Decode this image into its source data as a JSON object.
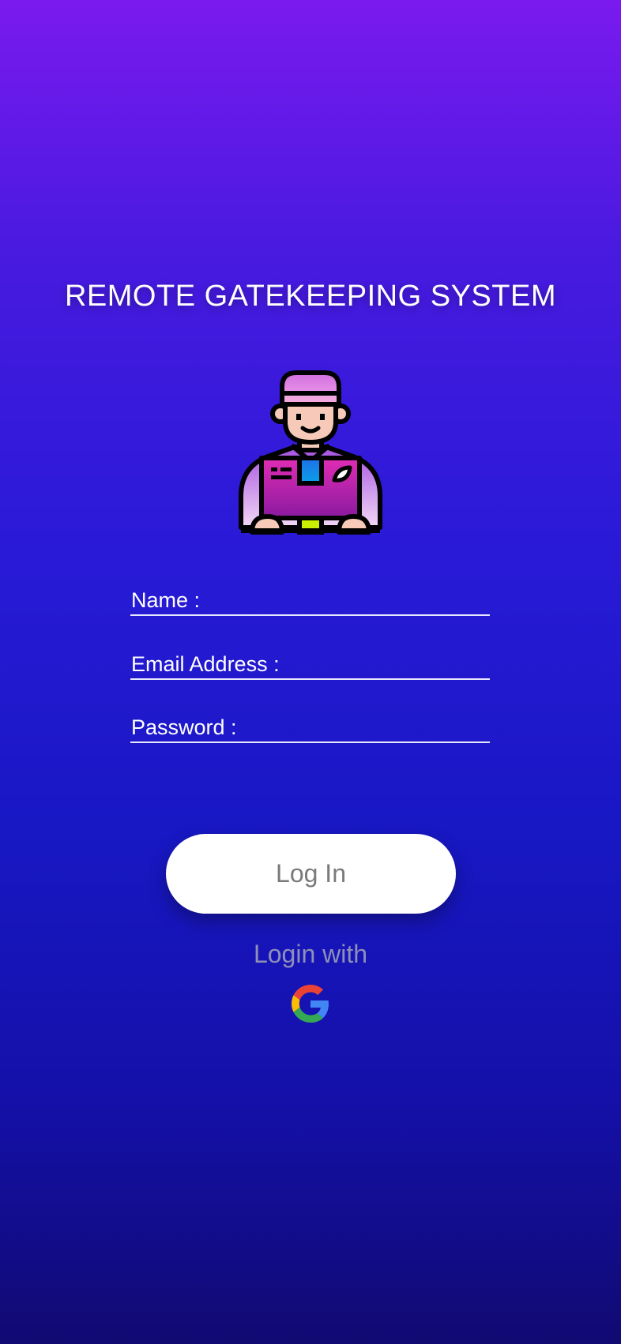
{
  "app": {
    "title": "REMOTE GATEKEEPING SYSTEM"
  },
  "form": {
    "name_label": "Name :",
    "email_label": "Email Address :",
    "password_label": "Password :",
    "name_value": "",
    "email_value": "",
    "password_value": ""
  },
  "actions": {
    "login_label": "Log In",
    "login_with_label": "Login with"
  },
  "icons": {
    "avatar": "delivery-man-avatar-icon",
    "google": "google-icon"
  },
  "colors": {
    "gradient_top": "#7a1aef",
    "gradient_bottom": "#110a72",
    "button_bg": "#ffffff",
    "button_text": "#7a7a7a",
    "login_with_text": "#8f8fb8"
  }
}
